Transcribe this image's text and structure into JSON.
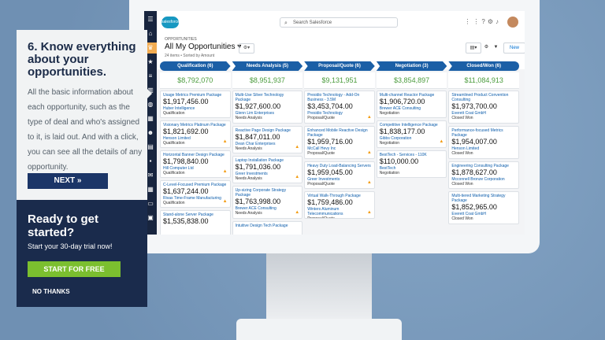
{
  "app": {
    "search_placeholder": "Search Salesforce",
    "logo_text": "salesforce",
    "object_label": "OPPORTUNITIES",
    "list_title": "All My Opportunities",
    "list_sub": "24 items • Sorted by Amount",
    "new_button": "New"
  },
  "stages": [
    {
      "label": "Qualification  (6)",
      "total": "$8,792,070"
    },
    {
      "label": "Needs Analysis  (5)",
      "total": "$8,951,937"
    },
    {
      "label": "Proposal/Quote  (6)",
      "total": "$9,131,951"
    },
    {
      "label": "Negotiation  (3)",
      "total": "$3,854,897"
    },
    {
      "label": "Closed/Won  (6)",
      "total": "$11,084,913"
    }
  ],
  "columns": [
    [
      {
        "name": "Usage Metrics Premium Package",
        "amount": "$1,917,456.00",
        "account": "Huber Intelligence",
        "stage": "Qualification",
        "warn": false
      },
      {
        "name": "Visionary Metrics Platinum Package",
        "amount": "$1,821,692.00",
        "account": "Henson Limited",
        "stage": "Qualification",
        "warn": true
      },
      {
        "name": "Horizontal Banner Design Package",
        "amount": "$1,798,840.00",
        "account": "Hill Computer Ltd",
        "stage": "Qualification",
        "warn": true
      },
      {
        "name": "C-Level-Focused Premium Package",
        "amount": "$1,637,244.00",
        "account": "Rivas Time-Frame Manufacturing",
        "stage": "Qualification",
        "warn": true
      },
      {
        "name": "Stand-alone Server Package",
        "amount": "$1,535,838.00",
        "account": "",
        "stage": "",
        "warn": false
      }
    ],
    [
      {
        "name": "Multi-Use Silver Technology Package",
        "amount": "$1,927,600.00",
        "account": "Glenn Lim Enterprises",
        "stage": "Needs Analysis",
        "warn": false
      },
      {
        "name": "Reactive Page Design Package",
        "amount": "$1,847,011.00",
        "account": "Dean Char Enterprises",
        "stage": "Needs Analysis",
        "warn": true
      },
      {
        "name": "Laptop Installation Package",
        "amount": "$1,791,036.00",
        "account": "Greer Investments",
        "stage": "Needs Analysis",
        "warn": true
      },
      {
        "name": "Up-sizing Corporate Strategy Package",
        "amount": "$1,763,998.00",
        "account": "Brewer ACE Consulting",
        "stage": "Needs Analysis",
        "warn": true
      },
      {
        "name": "Intuitive Design Tech Package",
        "amount": "",
        "account": "",
        "stage": "",
        "warn": false
      }
    ],
    [
      {
        "name": "Presidio Technology - Add-On Business - 3.5M",
        "amount": "$3,453,704.00",
        "account": "Presidio Technology",
        "stage": "Proposal/Quote",
        "warn": true
      },
      {
        "name": "Enhanced Mobile Reactive Design Package",
        "amount": "$1,959,716.00",
        "account": "McCall Hevy Inc",
        "stage": "Proposal/Quote",
        "warn": true
      },
      {
        "name": "Heavy Duty Load-Balancing Servers",
        "amount": "$1,959,045.00",
        "account": "Greer Investments",
        "stage": "Proposal/Quote",
        "warn": true
      },
      {
        "name": "Virtual Walk-Through Package",
        "amount": "$1,759,486.00",
        "account": "Winters Aluminum Telecommunications",
        "stage": "Proposal/Quote",
        "warn": true
      }
    ],
    [
      {
        "name": "Multi-channel Reactor Package",
        "amount": "$1,906,720.00",
        "account": "Brewer ACE Consulting",
        "stage": "Negotiation",
        "warn": false
      },
      {
        "name": "Competitive Intelligence Package",
        "amount": "$1,838,177.00",
        "account": "Gibbs Corporation",
        "stage": "Negotiation",
        "warn": true
      },
      {
        "name": "BestTech - Services - 110K",
        "amount": "$110,000.00",
        "account": "BestTech",
        "stage": "Negotiation",
        "warn": false
      }
    ],
    [
      {
        "name": "Streamlined Product Convention Consulting",
        "amount": "$1,973,700.00",
        "account": "Everett Coat GmbH",
        "stage": "Closed Won",
        "warn": false
      },
      {
        "name": "Performance-focused Metrics Package",
        "amount": "$1,954,007.00",
        "account": "Henson Limited",
        "stage": "Closed Won",
        "warn": false
      },
      {
        "name": "Engineering Consulting Package",
        "amount": "$1,878,627.00",
        "account": "Mcconnell Bronze Corporation",
        "stage": "Closed Won",
        "warn": false
      },
      {
        "name": "Multi-tiered Marketing Strategy Package",
        "amount": "$1,852,965.00",
        "account": "Everett Coat GmbH",
        "stage": "Closed Won",
        "warn": false
      }
    ]
  ],
  "panel": {
    "heading": "6. Know everything about your opportunities.",
    "body": "All the basic information about each opportunity, such as the type of deal and who's assigned to it, is laid out. And with a click, you can see all the details of any opportunity.",
    "next_label": "NEXT »",
    "cta_heading": "Ready to get started?",
    "trial_text": "Start your 30-day trial now!",
    "start_label": "START FOR FREE",
    "no_thanks_label": "NO THANKS"
  }
}
